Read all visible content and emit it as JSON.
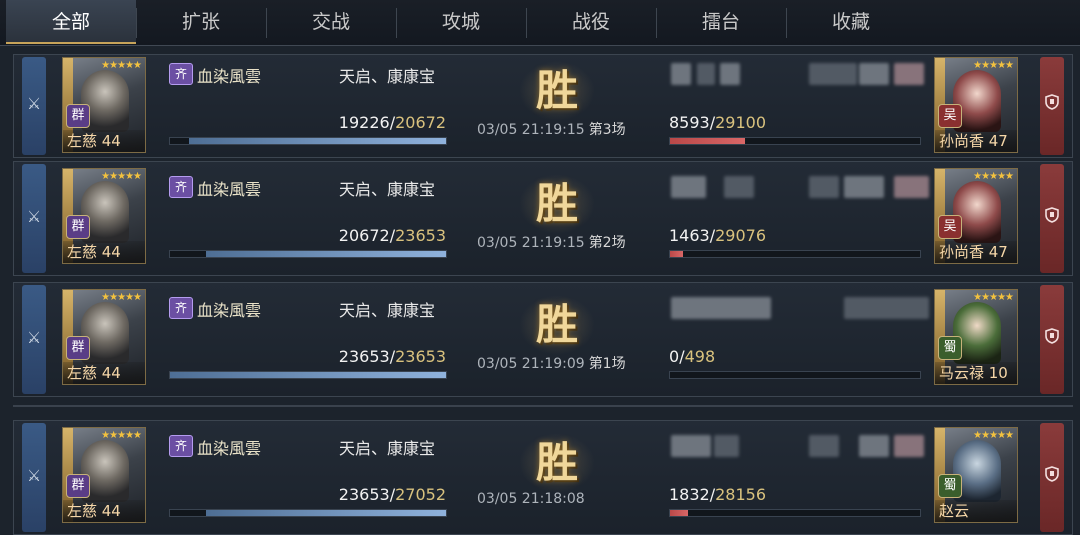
{
  "tabs": [
    {
      "label": "全部",
      "active": true
    },
    {
      "label": "扩张",
      "active": false
    },
    {
      "label": "交战",
      "active": false
    },
    {
      "label": "攻城",
      "active": false
    },
    {
      "label": "战役",
      "active": false
    },
    {
      "label": "擂台",
      "active": false
    },
    {
      "label": "收藏",
      "active": false
    }
  ],
  "colors": {
    "accent_gold": "#c8a45a",
    "attacker_blue": "#8fb2dc",
    "defender_red": "#d96767"
  },
  "battles": [
    {
      "attacker": {
        "name": "左慈 44",
        "faction": "群",
        "guild_badge": "齐",
        "guild": "血染風雲",
        "allies": "天启、康康宝",
        "troops_current": "19226",
        "troops_max": "20672",
        "troops_fraction": 0.93
      },
      "result": "胜",
      "time": "03/05 21:19:15",
      "round": "第3场",
      "defender": {
        "name": "孙尚香 47",
        "faction": "吴",
        "troops_current": "8593",
        "troops_max": "29100",
        "troops_fraction": 0.3
      }
    },
    {
      "attacker": {
        "name": "左慈 44",
        "faction": "群",
        "guild_badge": "齐",
        "guild": "血染風雲",
        "allies": "天启、康康宝",
        "troops_current": "20672",
        "troops_max": "23653",
        "troops_fraction": 0.87
      },
      "result": "胜",
      "time": "03/05 21:19:15",
      "round": "第2场",
      "defender": {
        "name": "孙尚香 47",
        "faction": "吴",
        "troops_current": "1463",
        "troops_max": "29076",
        "troops_fraction": 0.05
      }
    },
    {
      "attacker": {
        "name": "左慈 44",
        "faction": "群",
        "guild_badge": "齐",
        "guild": "血染風雲",
        "allies": "天启、康康宝",
        "troops_current": "23653",
        "troops_max": "23653",
        "troops_fraction": 1.0
      },
      "result": "胜",
      "time": "03/05 21:19:09",
      "round": "第1场",
      "defender": {
        "name": "马云禄 10",
        "faction": "蜀",
        "troops_current": "0",
        "troops_max": "498",
        "troops_fraction": 0.0
      }
    },
    {
      "attacker": {
        "name": "左慈 44",
        "faction": "群",
        "guild_badge": "齐",
        "guild": "血染風雲",
        "allies": "天启、康康宝",
        "troops_current": "23653",
        "troops_max": "27052",
        "troops_fraction": 0.87
      },
      "result": "胜",
      "time": "03/05 21:18:08",
      "round": "",
      "defender": {
        "name": "赵云",
        "faction": "蜀",
        "troops_current": "1832",
        "troops_max": "28156",
        "troops_fraction": 0.07
      }
    }
  ],
  "icons": {
    "attack": "sword-icon",
    "defense": "shield-icon",
    "hero_stars": "★★★★★"
  }
}
